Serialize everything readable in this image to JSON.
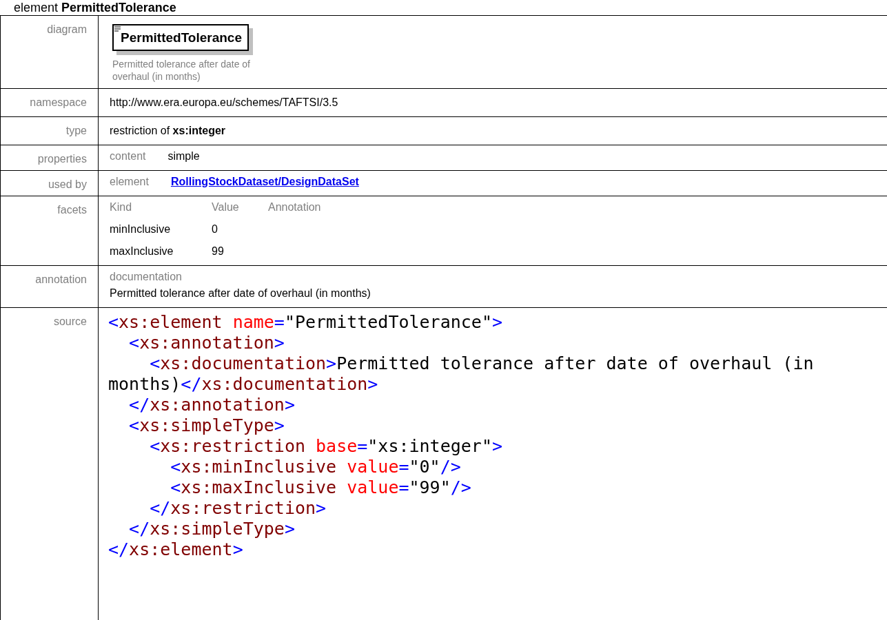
{
  "heading": "element **PermittedTolerance**",
  "rows": [
    {
      "kind": "diagram",
      "label": "diagram",
      "name": "PermittedTolerance",
      "description": "Permitted tolerance after date of overhaul (in months)"
    },
    {
      "kind": "plain",
      "label": "namespace",
      "value": "http://www.era.europa.eu/schemes/TAFTSI/3.5"
    },
    {
      "kind": "plain",
      "label": "type",
      "value": "restriction of **xs:integer**"
    },
    {
      "kind": "pair",
      "label": "properties",
      "key": "content",
      "value": "simple",
      "link": false
    },
    {
      "kind": "pair",
      "label": "used by",
      "key": "element",
      "value": "RollingStockDataset/DesignDataSet",
      "link": true
    },
    {
      "kind": "facets",
      "label": "facets",
      "columns": [
        "Kind",
        "Value",
        "Annotation"
      ],
      "facet_rows": [
        [
          "minInclusive",
          "0"
        ],
        [
          "maxInclusive",
          "99"
        ]
      ]
    },
    {
      "kind": "annotation",
      "label": "annotation",
      "key": "documentation",
      "value": "Permitted tolerance after date of overhaul (in months)"
    },
    {
      "kind": "source",
      "label": "source",
      "root": {
        "open": [
          {
            "kind": "punct",
            "text": "<"
          },
          {
            "kind": "tag",
            "text": "xs:element"
          },
          {
            "kind": "attr",
            "text": " name"
          },
          {
            "kind": "punct",
            "text": "="
          },
          {
            "kind": "value",
            "text": "\"PermittedTolerance\""
          },
          {
            "kind": "punct",
            "text": ">"
          }
        ],
        "close": [
          {
            "kind": "punct",
            "text": "</"
          },
          {
            "kind": "tag",
            "text": "xs:element"
          },
          {
            "kind": "punct",
            "text": ">"
          }
        ],
        "children": [
          {
            "open": [
              {
                "kind": "punct",
                "text": "<"
              },
              {
                "kind": "tag",
                "text": "xs:annotation"
              },
              {
                "kind": "punct",
                "text": ">"
              }
            ],
            "close": [
              {
                "kind": "punct",
                "text": "</"
              },
              {
                "kind": "tag",
                "text": "xs:annotation"
              },
              {
                "kind": "punct",
                "text": ">"
              }
            ],
            "children": [
              {
                "open": [
                  {
                    "kind": "punct",
                    "text": "<"
                  },
                  {
                    "kind": "tag",
                    "text": "xs:documentation"
                  },
                  {
                    "kind": "punct",
                    "text": ">"
                  }
                ],
                "text": "Permitted tolerance after date of overhaul (in months)",
                "close": [
                  {
                    "kind": "punct",
                    "text": "</"
                  },
                  {
                    "kind": "tag",
                    "text": "xs:documentation"
                  },
                  {
                    "kind": "punct",
                    "text": ">"
                  }
                ]
              }
            ]
          },
          {
            "open": [
              {
                "kind": "punct",
                "text": "<"
              },
              {
                "kind": "tag",
                "text": "xs:simpleType"
              },
              {
                "kind": "punct",
                "text": ">"
              }
            ],
            "close": [
              {
                "kind": "punct",
                "text": "</"
              },
              {
                "kind": "tag",
                "text": "xs:simpleType"
              },
              {
                "kind": "punct",
                "text": ">"
              }
            ],
            "children": [
              {
                "open": [
                  {
                    "kind": "punct",
                    "text": "<"
                  },
                  {
                    "kind": "tag",
                    "text": "xs:restriction"
                  },
                  {
                    "kind": "attr",
                    "text": " base"
                  },
                  {
                    "kind": "punct",
                    "text": "="
                  },
                  {
                    "kind": "value",
                    "text": "\"xs:integer\""
                  },
                  {
                    "kind": "punct",
                    "text": ">"
                  }
                ],
                "close": [
                  {
                    "kind": "punct",
                    "text": "</"
                  },
                  {
                    "kind": "tag",
                    "text": "xs:restriction"
                  },
                  {
                    "kind": "punct",
                    "text": ">"
                  }
                ],
                "children": [
                  {
                    "open": [
                      {
                        "kind": "punct",
                        "text": "<"
                      },
                      {
                        "kind": "tag",
                        "text": "xs:minInclusive"
                      },
                      {
                        "kind": "attr",
                        "text": " value"
                      },
                      {
                        "kind": "punct",
                        "text": "="
                      },
                      {
                        "kind": "value",
                        "text": "\"0\""
                      },
                      {
                        "kind": "punct",
                        "text": "/>"
                      }
                    ]
                  },
                  {
                    "open": [
                      {
                        "kind": "punct",
                        "text": "<"
                      },
                      {
                        "kind": "tag",
                        "text": "xs:maxInclusive"
                      },
                      {
                        "kind": "attr",
                        "text": " value"
                      },
                      {
                        "kind": "punct",
                        "text": "="
                      },
                      {
                        "kind": "value",
                        "text": "\"99\""
                      },
                      {
                        "kind": "punct",
                        "text": "/>"
                      }
                    ]
                  }
                ]
              }
            ]
          }
        ]
      }
    }
  ]
}
